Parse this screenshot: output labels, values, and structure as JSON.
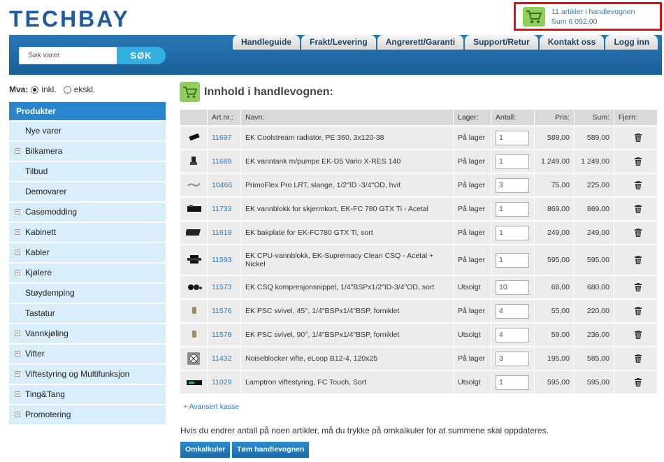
{
  "logo": {
    "text": "TECHBAY"
  },
  "cart_summary": {
    "line1": "11 artikler i handlevognen",
    "line2": "Sum 6 092,00"
  },
  "search": {
    "placeholder": "Søk varer",
    "button": "SØK"
  },
  "nav": [
    "Handleguide",
    "Frakt/Levering",
    "Angrerett/Garanti",
    "Support/Retur",
    "Kontakt oss",
    "Logg inn"
  ],
  "mva": {
    "label": "Mva:",
    "inkl": "inkl.",
    "ekskl": "ekskl.",
    "selected": "inkl."
  },
  "sidebar": {
    "header": "Produkter",
    "items": [
      {
        "label": "Nye varer",
        "expandable": false
      },
      {
        "label": "Bilkamera",
        "expandable": true
      },
      {
        "label": "Tilbud",
        "expandable": false
      },
      {
        "label": "Demovarer",
        "expandable": false
      },
      {
        "label": "Casemodding",
        "expandable": true
      },
      {
        "label": "Kabinett",
        "expandable": true
      },
      {
        "label": "Kabler",
        "expandable": true
      },
      {
        "label": "Kjølere",
        "expandable": true
      },
      {
        "label": "Støydemping",
        "expandable": false
      },
      {
        "label": "Tastatur",
        "expandable": false
      },
      {
        "label": "Vannkjøling",
        "expandable": true
      },
      {
        "label": "Vifter",
        "expandable": true
      },
      {
        "label": "Viftestyring og Multifunksjon",
        "expandable": true
      },
      {
        "label": "Ting&Tang",
        "expandable": true
      },
      {
        "label": "Promotering",
        "expandable": true
      }
    ]
  },
  "main": {
    "title": "Innhold i handlevognen:",
    "columns": [
      "Art.nr.:",
      "Navn:",
      "Lager:",
      "Antall:",
      "Pris:",
      "Sum:",
      "Fjern:"
    ],
    "rows": [
      {
        "art": "11697",
        "name": "EK Coolstream radiator, PE 360, 3x120-38",
        "stock": "På lager",
        "qty": "1",
        "price": "589,00",
        "sum": "589,00",
        "thumb": "radiator-icon"
      },
      {
        "art": "11669",
        "name": "EK vanntank m/pumpe EK-D5 Vario X-RES 140",
        "stock": "På lager",
        "qty": "1",
        "price": "1 249,00",
        "sum": "1 249,00",
        "thumb": "pump-icon"
      },
      {
        "art": "10466",
        "name": "PrimoFlex Pro LRT, slange, 1/2\"ID -3/4\"OD, hvit",
        "stock": "På lager",
        "qty": "3",
        "price": "75,00",
        "sum": "225,00",
        "thumb": "tube-icon"
      },
      {
        "art": "11733",
        "name": "EK vannblokk for skjermkort, EK-FC 780 GTX Ti - Acetal",
        "stock": "På lager",
        "qty": "1",
        "price": "869,00",
        "sum": "869,00",
        "thumb": "gpu-block-icon"
      },
      {
        "art": "11619",
        "name": "EK bakplate for EK-FC780 GTX Ti, sort",
        "stock": "På lager",
        "qty": "1",
        "price": "249,00",
        "sum": "249,00",
        "thumb": "backplate-icon"
      },
      {
        "art": "11593",
        "name": "EK CPU-vannblokk, EK-Supremacy Clean CSQ - Acetal + Nickel",
        "stock": "På lager",
        "qty": "1",
        "price": "595,00",
        "sum": "595,00",
        "thumb": "cpu-block-icon"
      },
      {
        "art": "11573",
        "name": "EK CSQ kompresjonsnippel, 1/4\"BSPx1/2\"ID-3/4\"OD, sort",
        "stock": "Utsolgt",
        "qty": "10",
        "price": "68,00",
        "sum": "680,00",
        "thumb": "fitting-icon"
      },
      {
        "art": "11576",
        "name": "EK PSC svivel, 45°, 1/4\"BSPx1/4\"BSP, forniklet",
        "stock": "På lager",
        "qty": "4",
        "price": "55,00",
        "sum": "220,00",
        "thumb": "swivel-icon"
      },
      {
        "art": "11578",
        "name": "EK PSC svivel, 90°, 1/4\"BSPx1/4\"BSP, forniklet",
        "stock": "Utsolgt",
        "qty": "4",
        "price": "59,00",
        "sum": "236,00",
        "thumb": "swivel-icon"
      },
      {
        "art": "11432",
        "name": "Noiseblocker vifte, eLoop B12-4, 120x25",
        "stock": "På lager",
        "qty": "3",
        "price": "195,00",
        "sum": "585,00",
        "thumb": "fan-icon"
      },
      {
        "art": "11029",
        "name": "Lamptron viftestyring, FC Touch, Sort",
        "stock": "Utsolgt",
        "qty": "1",
        "price": "595,00",
        "sum": "595,00",
        "thumb": "fan-controller-icon"
      }
    ],
    "advanced_link": "+ Avansert kasse",
    "notice": "Hvis du endrer antall på noen artikler, må du trykke på omkalkuler for at summene skal oppdateres.",
    "recalc_button": "Omkalkuler",
    "empty_button": "Tøm handlevognen"
  },
  "colors": {
    "brand_blue": "#1f5a9c",
    "accent_cyan": "#33aee0",
    "cart_green": "#8fcf5c",
    "highlight_red": "#e01010",
    "link": "#2a7ab8"
  }
}
